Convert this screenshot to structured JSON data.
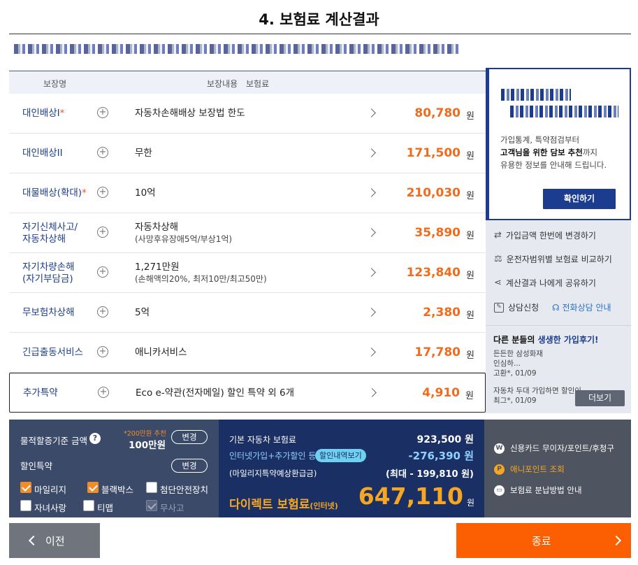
{
  "title": "4. 보험료 계산결과",
  "table": {
    "headers": {
      "coverage": "보장명",
      "content": "보장내용",
      "premium": "보험료"
    },
    "rows": [
      {
        "name": "대인배상I",
        "star": "*",
        "desc": "자동차손해배상 보장법 한도",
        "sub": "",
        "amount": "80,780",
        "unit": "원"
      },
      {
        "name": "대인배상II",
        "star": "",
        "desc": "무한",
        "sub": "",
        "amount": "171,500",
        "unit": "원"
      },
      {
        "name": "대물배상(확대)",
        "star": "*",
        "desc": "10억",
        "sub": "",
        "amount": "210,030",
        "unit": "원"
      },
      {
        "name": "자기신체사고/",
        "name2": "자동차상해",
        "star": "",
        "desc": "자동차상해",
        "sub": "(사망후유장애5억/부상1억)",
        "amount": "35,890",
        "unit": "원"
      },
      {
        "name": "자기차량손해",
        "name2": "(자기부담금)",
        "star": "",
        "desc": "1,271만원",
        "sub": "(손해액의20%, 최저10만/최고50만)",
        "amount": "123,840",
        "unit": "원"
      },
      {
        "name": "무보험차상해",
        "star": "",
        "desc": "5억",
        "sub": "",
        "amount": "2,380",
        "unit": "원"
      },
      {
        "name": "긴급출동서비스",
        "star": "",
        "desc": "애니카서비스",
        "sub": "",
        "amount": "17,780",
        "unit": "원"
      },
      {
        "name": "추가특약",
        "star": "",
        "desc": "Eco e-약관(전자메일) 할인 특약 외 6개",
        "sub": "",
        "amount": "4,910",
        "unit": "원"
      }
    ]
  },
  "side": {
    "promo_line1": "가입통계, 특약점검부터",
    "promo_line2_bold": "고객님을 위한 담보 추천",
    "promo_line2_rest": "까지",
    "promo_line3": "유용한 정보를 안내해 드립니다.",
    "confirm_label": "확인하기",
    "links": [
      {
        "icon": "shuffle-icon",
        "label": "가입금액 한번에 변경하기"
      },
      {
        "icon": "scale-icon",
        "label": "운전자범위별 보험료 비교하기"
      },
      {
        "icon": "share-icon",
        "label": "계산결과 나에게 공유하기"
      }
    ],
    "consult_label": "상담신청",
    "call_label": "전화상담 안내",
    "reviews_title_a": "다른 분들의 ",
    "reviews_title_b": "생생한 가입후기!",
    "reviews": [
      {
        "text": "든든한 삼성화재",
        "text2": "인심하...",
        "meta": "고환*, 01/09"
      },
      {
        "text": "자동차 두대 가입하면 할인이",
        "text2": "",
        "meta": "최그*, 01/09"
      }
    ],
    "more_label": "더보기"
  },
  "bottom": {
    "property_label": "물적할증기준 금액",
    "property_hint": "*200만원 추천",
    "property_value": "100만원",
    "change_label": "변경",
    "discount_label": "할인특약",
    "checks": [
      {
        "label": "마일리지",
        "state": "on"
      },
      {
        "label": "블랙박스",
        "state": "on"
      },
      {
        "label": "첨단안전장치",
        "state": "off"
      },
      {
        "label": "자녀사랑",
        "state": "off"
      },
      {
        "label": "티맵",
        "state": "off"
      },
      {
        "label": "무사고",
        "state": "disabled"
      }
    ],
    "base_label": "기본 자동차 보험료",
    "base_value": "923,500 원",
    "discount_line_label": "인터넷가입+추가할인 등",
    "discount_badge": "할인내역보기",
    "discount_value": "-276,390 원",
    "refund_label": "(마일리지특약예상환급금)",
    "refund_value": "(최대 - 199,810 원)",
    "final_label": "다이렉트 보험료",
    "final_sub": "(인터넷)",
    "final_value": "647,110",
    "final_unit": "원",
    "right_links": [
      {
        "icon": "won-icon",
        "label": "신용카드 무이자/포인트/후청구",
        "color": "#ffffff"
      },
      {
        "icon": "point-icon",
        "label": "애니포인트 조회",
        "color": "#f5a623"
      },
      {
        "icon": "card-icon",
        "label": "보험료 분납방법 안내",
        "color": "#ffffff"
      }
    ]
  },
  "nav": {
    "prev_label": "이전",
    "end_label": "종료"
  },
  "colors": {
    "navy": "#1c3d8f",
    "orange": "#fc5f02",
    "amount": "#f26a1b"
  }
}
